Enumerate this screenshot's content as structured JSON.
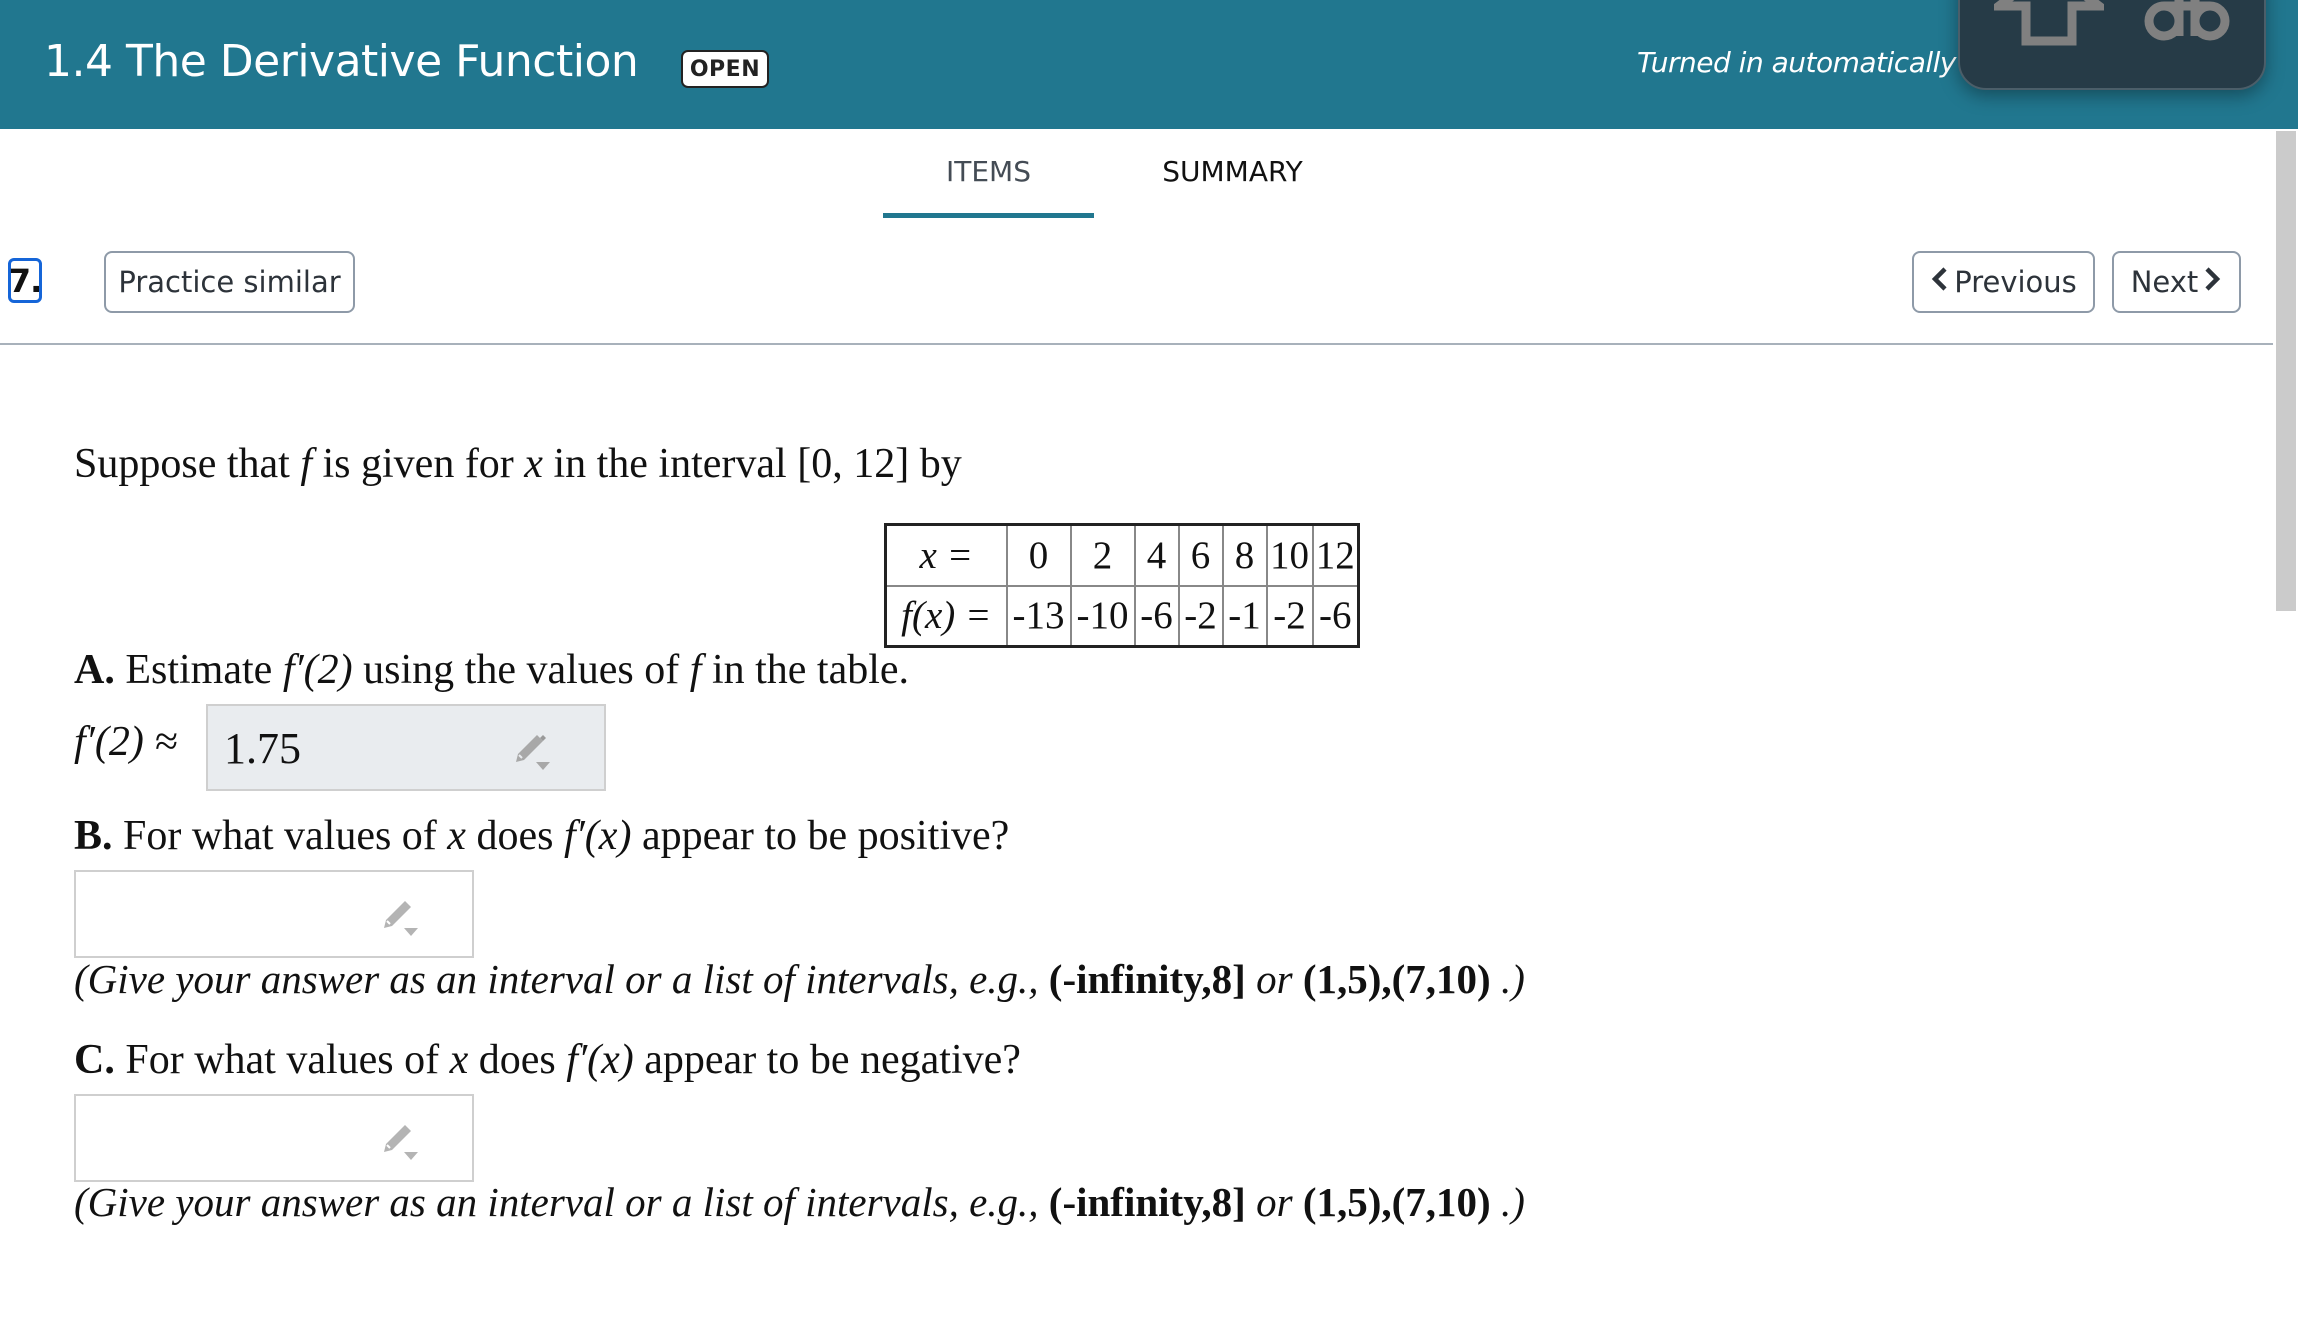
{
  "header": {
    "title": "1.4 The Derivative Function",
    "status_badge": "OPEN",
    "turned_in_text": "Turned in automatically",
    "background_color": "#21778f"
  },
  "key_overlay": {
    "keys": [
      "shift-key-icon",
      "command-key-icon"
    ]
  },
  "tabs": [
    {
      "label": "ITEMS",
      "active": true
    },
    {
      "label": "SUMMARY",
      "active": false
    }
  ],
  "item": {
    "number": "7.",
    "practice_label": "Practice similar",
    "previous_label": "Previous",
    "next_label": "Next"
  },
  "question": {
    "intro": {
      "p1": "Suppose that ",
      "f": "f",
      "p2": " is given for ",
      "x": "x",
      "p3": " in the interval ",
      "interval": "[0, 12]",
      "p4": " by"
    },
    "table": {
      "x_label": "x =",
      "fx_label": "f(x) =",
      "x_values": [
        "0",
        "2",
        "4",
        "6",
        "8",
        "10",
        "12"
      ],
      "fx_values": [
        "-13",
        "-10",
        "-6",
        "-2",
        "-1",
        "-2",
        "-6"
      ]
    },
    "part_a": {
      "letter": "A.",
      "p1": " Estimate ",
      "fp2": "f′(2)",
      "p2": " using the values of ",
      "f": "f",
      "p3": " in the table.",
      "answer_label": "f′(2) ≈",
      "answer_value": "1.75"
    },
    "part_b": {
      "letter": "B.",
      "p1": " For what values of ",
      "x": "x",
      "p2": " does ",
      "fpx": "f′(x)",
      "p3": " appear to be positive?",
      "answer_value": ""
    },
    "part_c": {
      "letter": "C.",
      "p1": " For what values of ",
      "x": "x",
      "p2": " does ",
      "fpx": "f′(x)",
      "p3": " appear to be negative?",
      "answer_value": ""
    },
    "hint": {
      "p1": "(Give your answer as an interval or a list of intervals, e.g., ",
      "ex1": "(-infinity,8]",
      "p2": " or ",
      "ex2": "(1,5),(7,10)",
      "p3": " .)"
    }
  }
}
